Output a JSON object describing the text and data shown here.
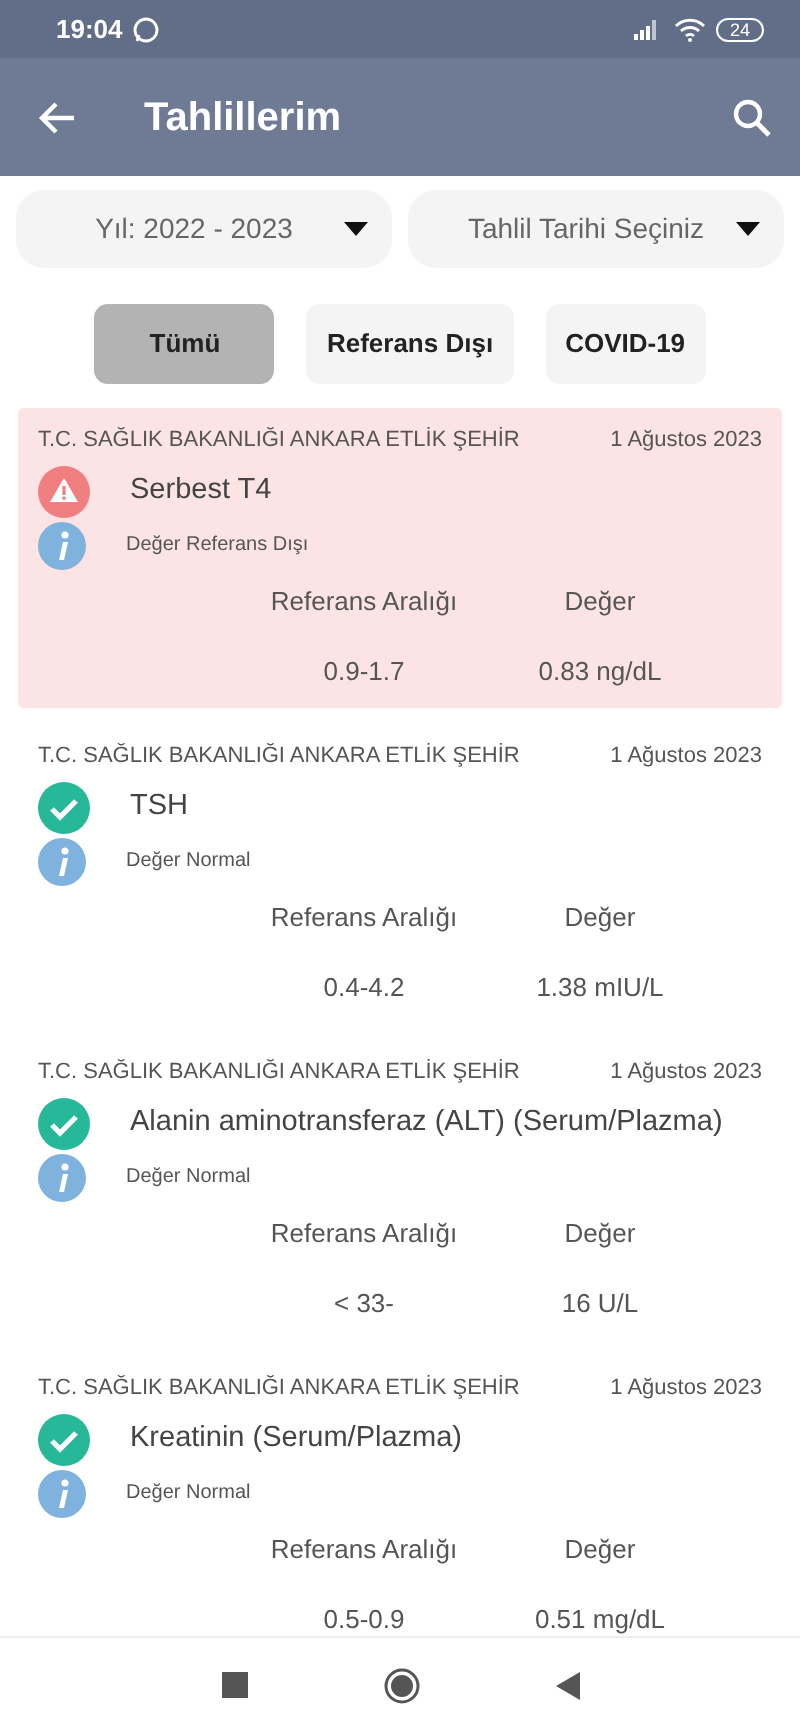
{
  "status_bar": {
    "time": "19:04",
    "battery": "24"
  },
  "app_bar": {
    "title": "Tahlillerim"
  },
  "dropdowns": [
    {
      "value": "Yıl: 2022 - 2023"
    },
    {
      "value": "Tahlil Tarihi Seçiniz"
    }
  ],
  "filters": [
    {
      "label": "Tümü",
      "selected": true
    },
    {
      "label": "Referans Dışı",
      "selected": false
    },
    {
      "label": "COVID-19",
      "selected": false
    }
  ],
  "results": [
    {
      "institution": "T.C. SAĞLIK BAKANLIĞI ANKARA ETLİK ŞEHİR",
      "date": "1 Ağustos 2023",
      "test": "Serbest T4",
      "kind": "abnormal",
      "status_text": "Değer Referans Dışı",
      "range_label": "Referans Aralığı",
      "value_label": "Değer",
      "range": "0.9-1.7",
      "value": "0.83 ng/dL"
    },
    {
      "institution": "T.C. SAĞLIK BAKANLIĞI ANKARA ETLİK ŞEHİR",
      "date": "1 Ağustos 2023",
      "test": "TSH",
      "kind": "normal",
      "status_text": "Değer Normal",
      "range_label": "Referans Aralığı",
      "value_label": "Değer",
      "range": "0.4-4.2",
      "value": "1.38 mIU/L"
    },
    {
      "institution": "T.C. SAĞLIK BAKANLIĞI ANKARA ETLİK ŞEHİR",
      "date": "1 Ağustos 2023",
      "test": "Alanin aminotransferaz (ALT) (Serum/Plazma)",
      "kind": "normal",
      "status_text": "Değer Normal",
      "range_label": "Referans Aralığı",
      "value_label": "Değer",
      "range": "< 33-",
      "value": "16 U/L"
    },
    {
      "institution": "T.C. SAĞLIK BAKANLIĞI ANKARA ETLİK ŞEHİR",
      "date": "1 Ağustos 2023",
      "test": "Kreatinin (Serum/Plazma)",
      "kind": "normal",
      "status_text": "Değer Normal",
      "range_label": "Referans Aralığı",
      "value_label": "Değer",
      "range": "0.5-0.9",
      "value": "0.51 mg/dL"
    }
  ]
}
